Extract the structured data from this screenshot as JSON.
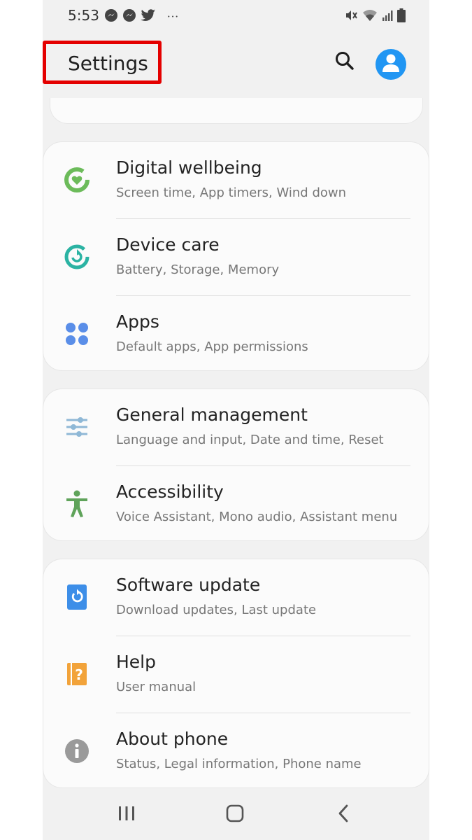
{
  "status": {
    "time": "5:53",
    "left_icons": [
      "messenger-icon",
      "messenger-icon",
      "twitter-icon"
    ],
    "more": "···",
    "right_icons": [
      "mute-icon",
      "wifi-icon",
      "signal-icon",
      "battery-icon"
    ]
  },
  "header": {
    "title": "Settings",
    "highlight_color": "#e40000",
    "accent": "#2196f3"
  },
  "groups": [
    {
      "items": [
        {
          "label": "Digital wellbeing",
          "sub": "Screen time, App timers, Wind down",
          "icon": "digital-wellbeing-icon",
          "color": "#6cbb5a"
        },
        {
          "label": "Device care",
          "sub": "Battery, Storage, Memory",
          "icon": "device-care-icon",
          "color": "#2bb3a3"
        },
        {
          "label": "Apps",
          "sub": "Default apps, App permissions",
          "icon": "apps-icon",
          "color": "#5a8ee8"
        }
      ]
    },
    {
      "items": [
        {
          "label": "General management",
          "sub": "Language and input, Date and time, Reset",
          "icon": "general-management-icon",
          "color": "#8fb8d6"
        },
        {
          "label": "Accessibility",
          "sub": "Voice Assistant, Mono audio, Assistant menu",
          "icon": "accessibility-icon",
          "color": "#5fa35a"
        }
      ]
    },
    {
      "items": [
        {
          "label": "Software update",
          "sub": "Download updates, Last update",
          "icon": "software-update-icon",
          "color": "#3d8ee8"
        },
        {
          "label": "Help",
          "sub": "User manual",
          "icon": "help-icon",
          "color": "#f2a33a"
        },
        {
          "label": "About phone",
          "sub": "Status, Legal information, Phone name",
          "icon": "about-phone-icon",
          "color": "#9a9a9a"
        }
      ]
    }
  ],
  "navbar": [
    "recent-apps-icon",
    "home-icon",
    "back-icon"
  ]
}
